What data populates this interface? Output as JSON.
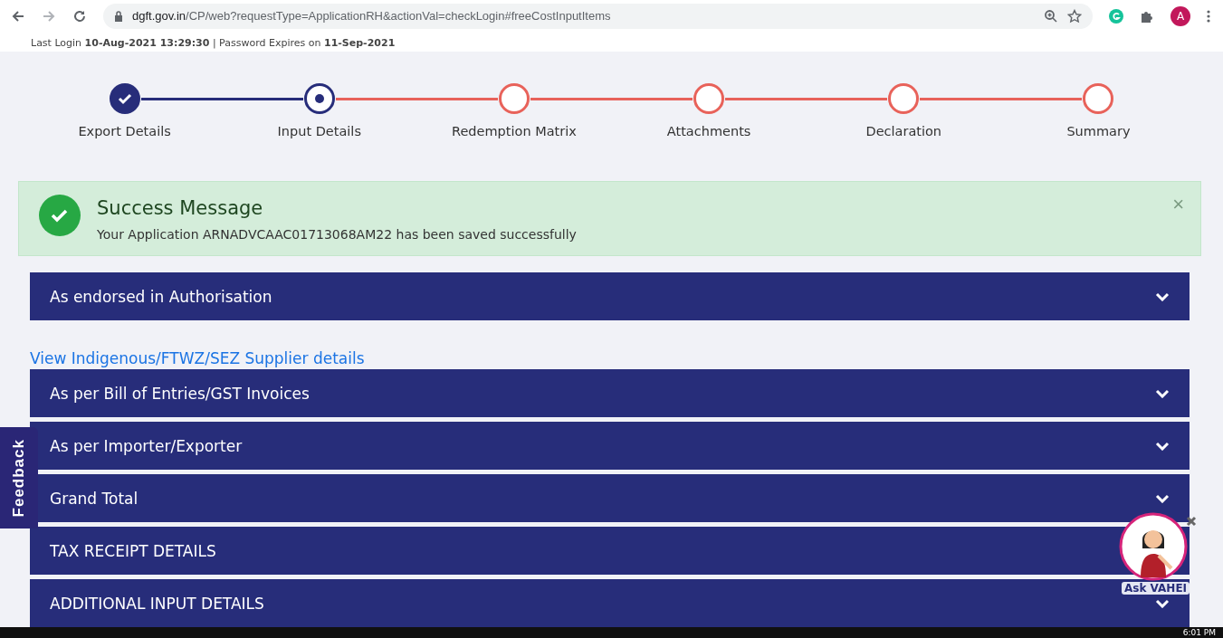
{
  "browser": {
    "url_host": "dgft.gov.in",
    "url_path": "/CP/web?requestType=ApplicationRH&actionVal=checkLogin#freeCostInputItems",
    "profile_initial": "A"
  },
  "login_info": {
    "last_login_label": "Last Login",
    "last_login": "10-Aug-2021 13:29:30",
    "separator": "|",
    "expires_label": "Password Expires on",
    "expires": "11-Sep-2021"
  },
  "steps": [
    {
      "label": "Export Details",
      "completed": true,
      "selected": false
    },
    {
      "label": "Input Details",
      "completed": false,
      "selected": true
    },
    {
      "label": "Redemption Matrix",
      "completed": false,
      "selected": false
    },
    {
      "label": "Attachments",
      "completed": false,
      "selected": false
    },
    {
      "label": "Declaration",
      "completed": false,
      "selected": false
    },
    {
      "label": "Summary",
      "completed": false,
      "selected": false
    }
  ],
  "alert": {
    "title": "Success Message",
    "message": "Your Application ARNADVCAAC01713068AM22 has been saved successfully",
    "close": "×"
  },
  "sections": [
    {
      "kind": "panel",
      "title": "As endorsed in Authorisation",
      "expanded": false
    },
    {
      "kind": "link",
      "title": "View Indigenous/FTWZ/SEZ Supplier details"
    },
    {
      "kind": "panel",
      "title": "As per Bill of Entries/GST Invoices",
      "expanded": false
    },
    {
      "kind": "panel",
      "title": "As per Importer/Exporter",
      "expanded": false
    },
    {
      "kind": "panel",
      "title": "Grand Total",
      "expanded": false
    },
    {
      "kind": "panel",
      "title": "TAX RECEIPT DETAILS",
      "expanded": false
    },
    {
      "kind": "panel",
      "title": "ADDITIONAL INPUT DETAILS",
      "expanded": false
    }
  ],
  "feedback": {
    "label": "Feedback"
  },
  "chatbot": {
    "label": "Ask VAHEI"
  },
  "taskbar": {
    "time": "6:01 PM"
  }
}
